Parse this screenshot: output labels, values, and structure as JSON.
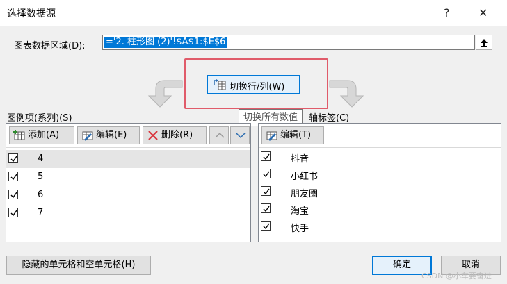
{
  "window": {
    "title": "选择数据源",
    "help_glyph": "?",
    "close_glyph": "✕"
  },
  "range": {
    "label": "图表数据区域(D):",
    "value": "='2. 柱形图 (2)'!$A$1:$E$6"
  },
  "switch": {
    "label": "切换行/列(W)",
    "tooltip": "切换所有数值"
  },
  "legend": {
    "label": "图例项(系列)(S)",
    "add_label": "添加(A)",
    "edit_label": "编辑(E)",
    "delete_label": "删除(R)",
    "items": [
      {
        "label": "4",
        "checked": true,
        "selected": true
      },
      {
        "label": "5",
        "checked": true
      },
      {
        "label": "6",
        "checked": true
      },
      {
        "label": "7",
        "checked": true
      }
    ]
  },
  "axis": {
    "label": "水平(分类)轴标签(C)",
    "visible_label_tail": "轴标签(C)",
    "edit_label": "编辑(T)",
    "items": [
      {
        "label": "抖音",
        "checked": true
      },
      {
        "label": "小红书",
        "checked": true
      },
      {
        "label": "朋友圈",
        "checked": true
      },
      {
        "label": "淘宝",
        "checked": true
      },
      {
        "label": "快手",
        "checked": true
      }
    ]
  },
  "footer": {
    "hidden_cells_label": "隐藏的单元格和空单元格(H)",
    "ok_label": "确定",
    "cancel_label": "取消"
  },
  "watermark": "CSDN @小车要奋进",
  "colors": {
    "accent": "#0078d7",
    "highlight_border": "#e05b6a",
    "delete_red": "#d9363e"
  }
}
